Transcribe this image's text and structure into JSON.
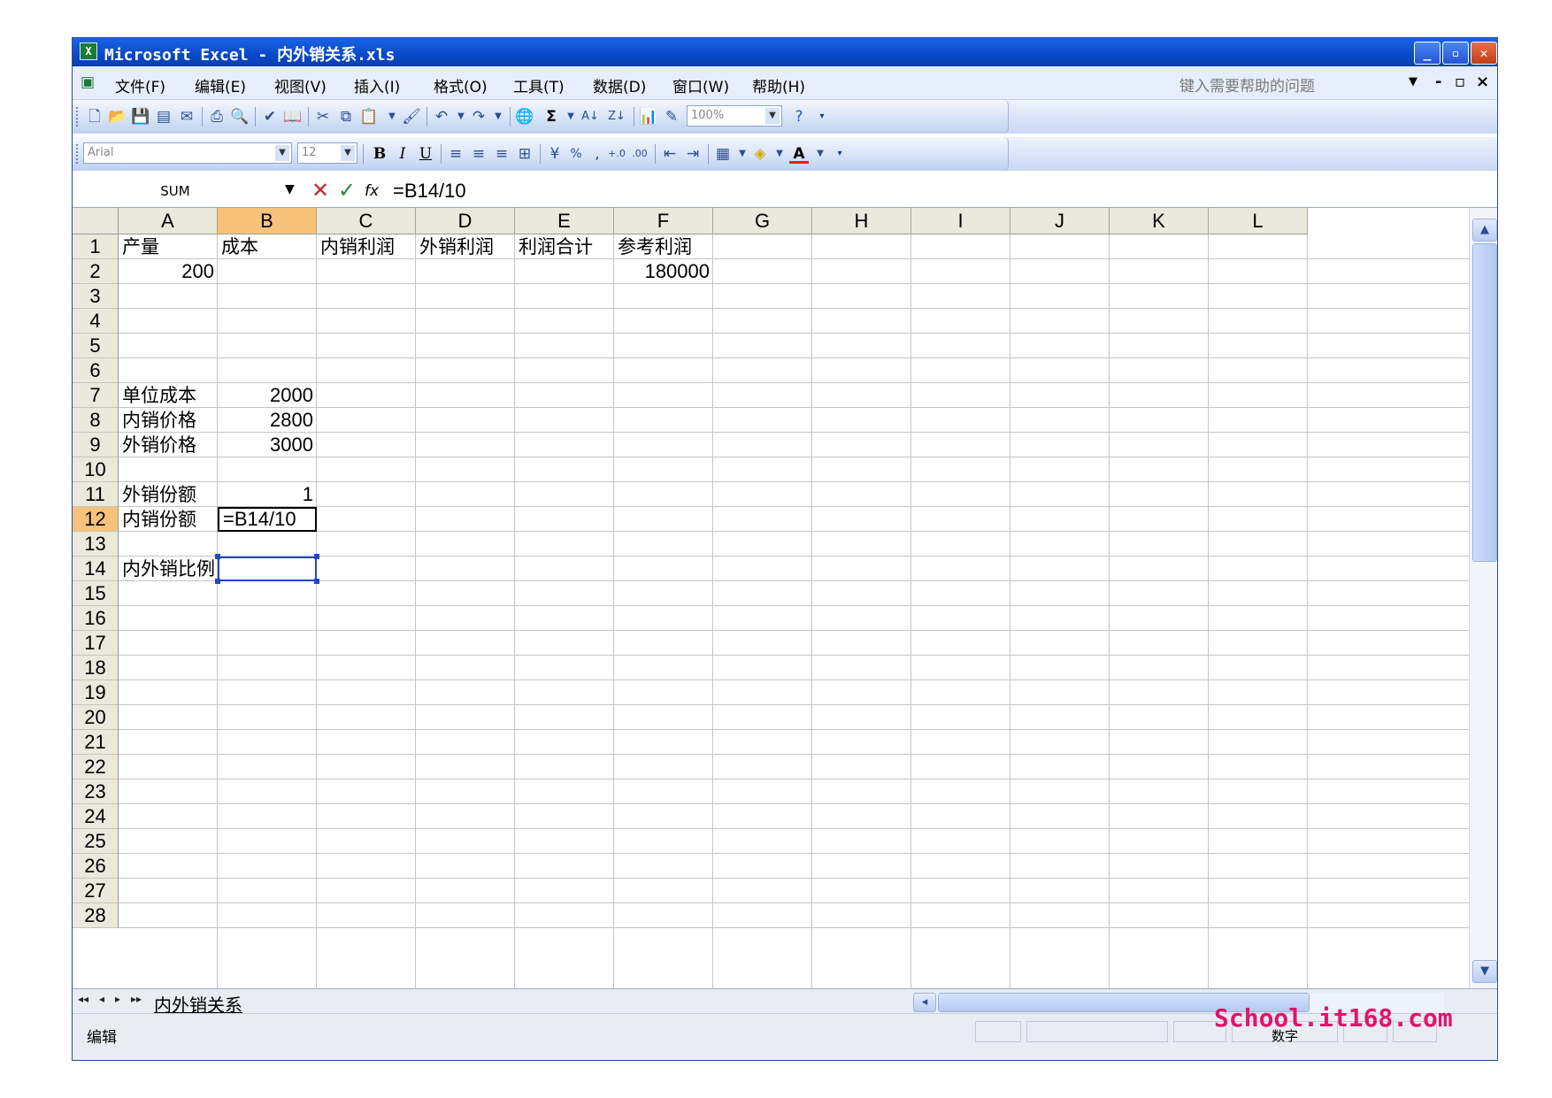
{
  "window": {
    "title": "Microsoft Excel - 内外销关系.xls",
    "icon": "excel-app-icon",
    "controls": {
      "minimize": "_",
      "restore": "▫",
      "close": "✕"
    }
  },
  "menu": {
    "items": [
      "文件(F)",
      "编辑(E)",
      "视图(V)",
      "插入(I)",
      "格式(O)",
      "工具(T)",
      "数据(D)",
      "窗口(W)",
      "帮助(H)"
    ],
    "help_placeholder": "键入需要帮助的问题",
    "mdi_controls": [
      "-",
      "▫",
      "×"
    ]
  },
  "toolbar_standard": {
    "zoom": "100%"
  },
  "toolbar_format": {
    "font": "Arial",
    "size": "12",
    "bold": "B",
    "italic": "I",
    "underline": "U",
    "percent": "%"
  },
  "formula_bar": {
    "name_box": "SUM",
    "cancel": "✕",
    "enter": "✓",
    "fx": "fx",
    "content": "=B14/10"
  },
  "sheet": {
    "columns": [
      "A",
      "B",
      "C",
      "D",
      "E",
      "F",
      "G",
      "H",
      "I",
      "J",
      "K",
      "L"
    ],
    "selected_column": "B",
    "rows": [
      "1",
      "2",
      "3",
      "4",
      "5",
      "6",
      "7",
      "8",
      "9",
      "10",
      "11",
      "12",
      "13",
      "14",
      "15",
      "16",
      "17",
      "18",
      "19",
      "20",
      "21",
      "22",
      "23",
      "24",
      "25",
      "26",
      "27",
      "28"
    ],
    "selected_row": "12",
    "cells": {
      "A1": "产量",
      "B1": "成本",
      "C1": "内销利润",
      "D1": "外销利润",
      "E1": "利润合计",
      "F1": "参考利润",
      "A2": "200",
      "F2": "180000",
      "A7": "单位成本",
      "B7": "2000",
      "A8": "内销价格",
      "B8": "2800",
      "A9": "外销价格",
      "B9": "3000",
      "A11": "外销份额",
      "B11": "1",
      "A12": "内销份额",
      "B12": "=B14/10",
      "A14": "内外销比例"
    }
  },
  "tabs": {
    "nav": [
      "◂◂",
      "◂",
      "▸",
      "▸▸"
    ],
    "sheet_name": "内外销关系"
  },
  "status": {
    "mode": "编辑",
    "num": "数字",
    "watermark": "School.it168.com"
  }
}
